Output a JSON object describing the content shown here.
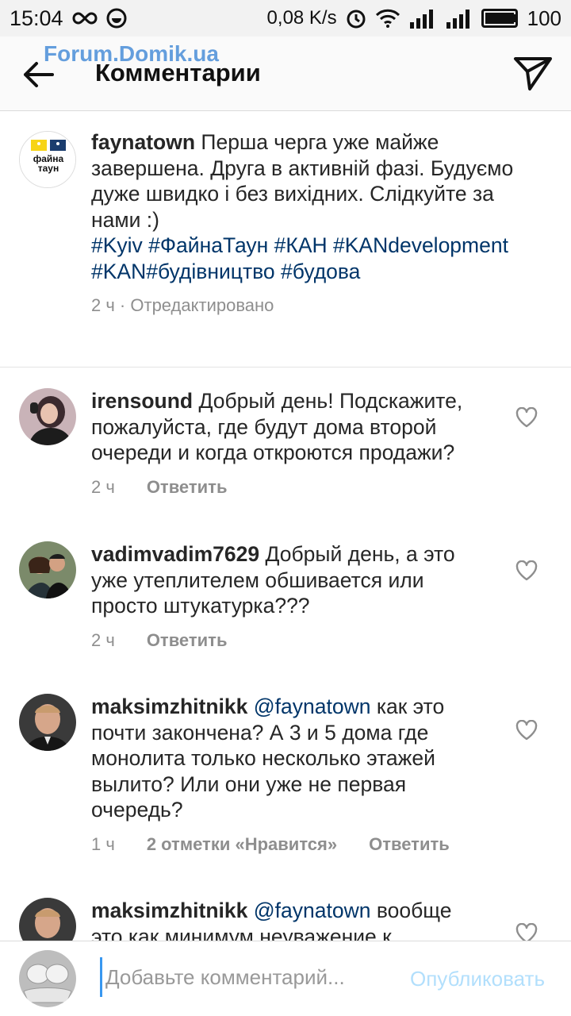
{
  "status_bar": {
    "time": "15:04",
    "net_speed": "0,08 K/s",
    "battery": "100"
  },
  "header": {
    "title": "Комментарии",
    "watermark": "Forum.Domik.ua"
  },
  "caption": {
    "avatar_text": "файна таун",
    "username": "faynatown",
    "text": "Перша черга уже майже завершена. Друга в активній фазі. Будуємо дуже швидко і без вихідних. Слідкуйте за нами :)",
    "hashtags": "#Kyiv #ФайнаТаун #КАН #KANdevelopment #KAN#будівництво #будова",
    "time": "2 ч",
    "edited": "Отредактировано"
  },
  "comments": [
    {
      "username": "irensound",
      "mention": "",
      "text": "Добрый день! Подскажите, пожалуйста, где будут дома второй очереди и когда откроются продажи?",
      "time": "2 ч",
      "likes": "",
      "reply": "Ответить"
    },
    {
      "username": "vadimvadim7629",
      "mention": "",
      "text": "Добрый день, а это уже утеплителем обшивается или просто штукатурка???",
      "time": "2 ч",
      "likes": "",
      "reply": "Ответить"
    },
    {
      "username": "maksimzhitnikk",
      "mention": "@faynatown",
      "text": " как это почти закончена? А 3 и 5 дома где монолита только несколько этажей вылито? Или они уже не первая очередь?",
      "time": "1 ч",
      "likes": "2 отметки «Нравится»",
      "reply": "Ответить"
    },
    {
      "username": "maksimzhitnikk",
      "mention": "@faynatown",
      "text": "вообще это как минимум неуважение к",
      "time": "",
      "likes": "",
      "reply": ""
    }
  ],
  "bottom_bar": {
    "placeholder": "Добавьте комментарий...",
    "publish": "Опубликовать"
  },
  "colors": {
    "link": "#003569",
    "muted": "#8e8e8e",
    "publish_disabled": "#b2dffc"
  }
}
